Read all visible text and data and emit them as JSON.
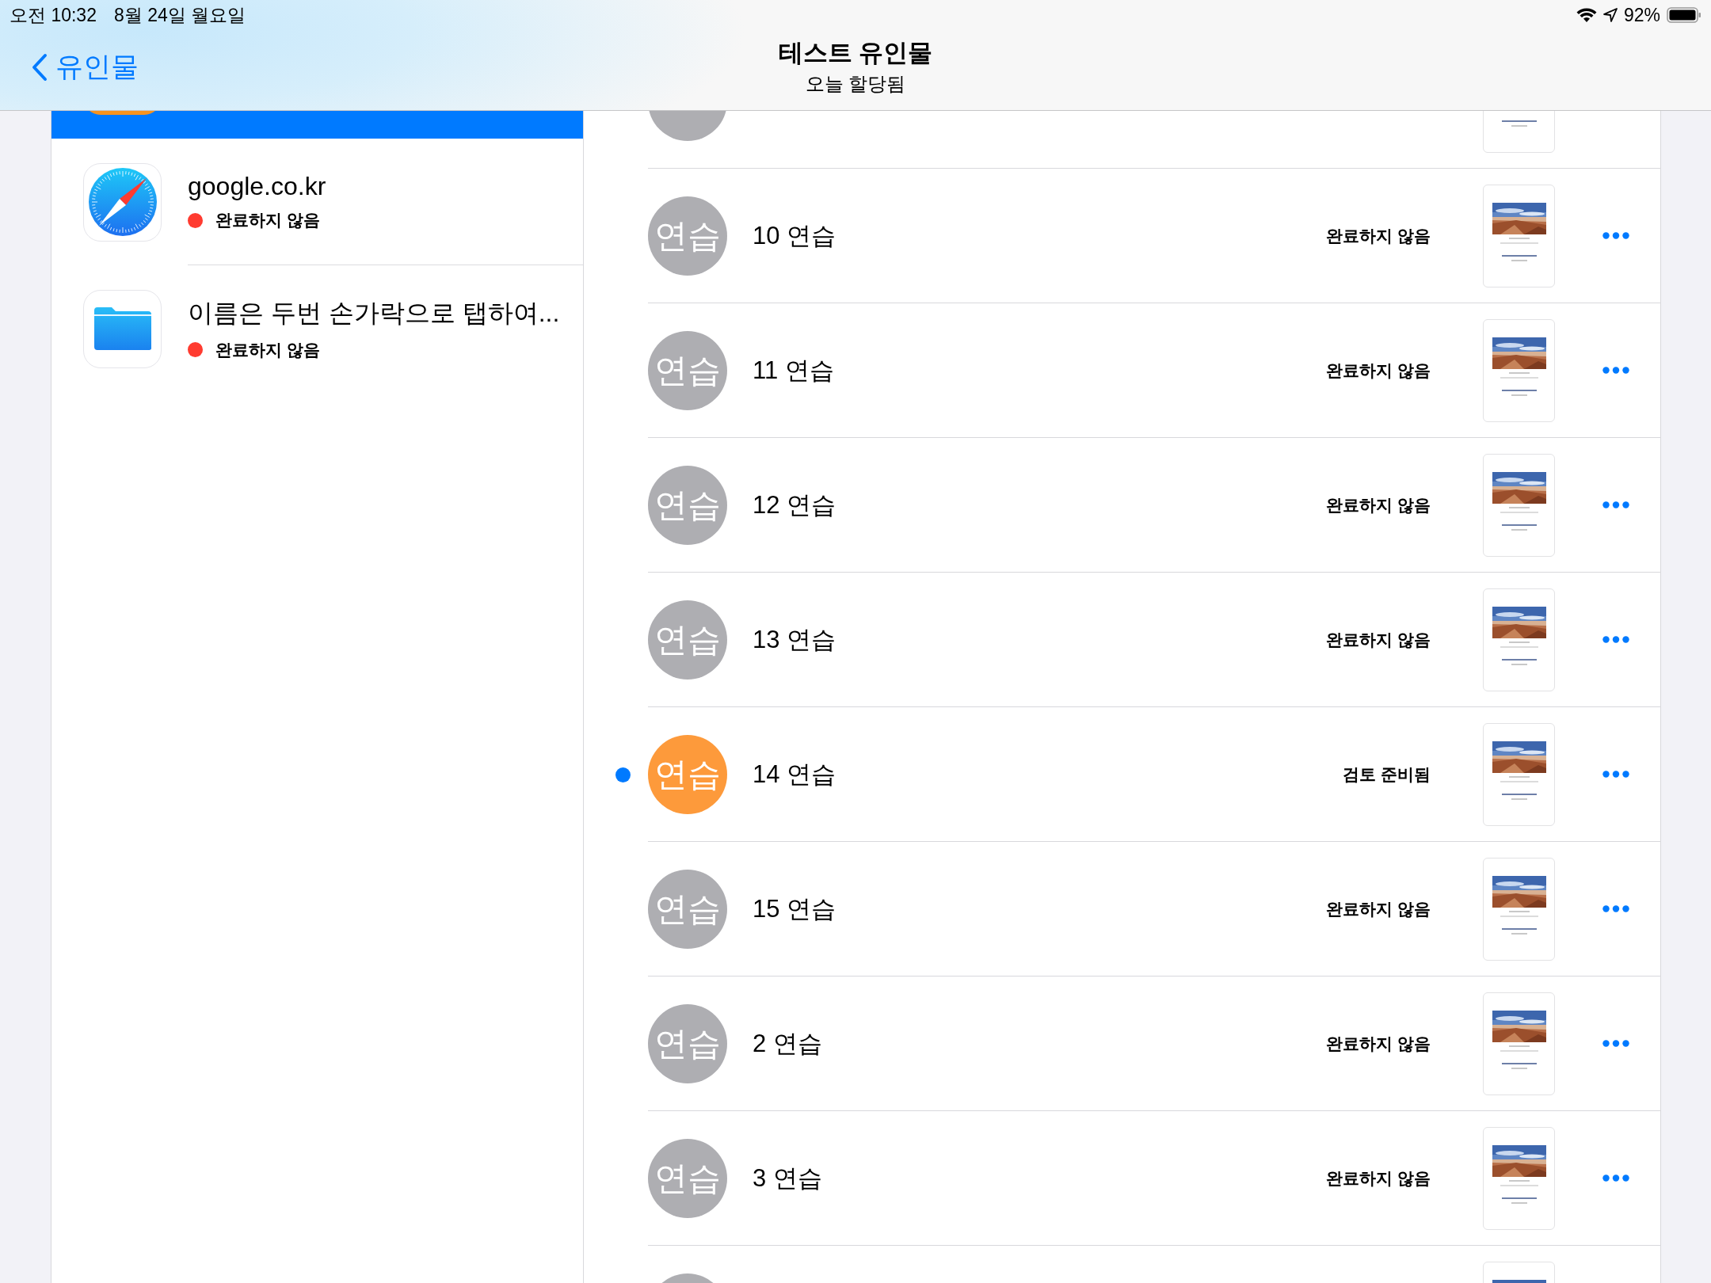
{
  "status_bar": {
    "time": "오전 10:32",
    "date": "8월 24일 월요일",
    "battery": "92%"
  },
  "nav": {
    "back": "유인물",
    "title": "테스트 유인물",
    "subtitle": "오늘 할당됨"
  },
  "sidebar": {
    "items": [
      {
        "kind": "partial",
        "selected": true
      },
      {
        "kind": "web",
        "title": "google.co.kr",
        "status": "완료하지 않음",
        "color": "#ff3b30",
        "selected": false
      },
      {
        "kind": "file",
        "title": "이름은 두번 손가락으로 탭하여...",
        "status": "완료하지 않음",
        "color": "#ff3b30",
        "selected": false
      }
    ]
  },
  "assignments": [
    {
      "kind": "partial_top",
      "color": "#aeaeb2",
      "unread": false
    },
    {
      "kind": "full",
      "avatar": "연습",
      "title": "10 연습",
      "status": "완료하지 않음",
      "color": "#aeaeb2",
      "unread": false
    },
    {
      "kind": "full",
      "avatar": "연습",
      "title": "11 연습",
      "status": "완료하지 않음",
      "color": "#aeaeb2",
      "unread": false
    },
    {
      "kind": "full",
      "avatar": "연습",
      "title": "12 연습",
      "status": "완료하지 않음",
      "color": "#aeaeb2",
      "unread": false
    },
    {
      "kind": "full",
      "avatar": "연습",
      "title": "13 연습",
      "status": "완료하지 않음",
      "color": "#aeaeb2",
      "unread": false
    },
    {
      "kind": "full",
      "avatar": "연습",
      "title": "14 연습",
      "status": "검토 준비됨",
      "color": "#fd9a3b",
      "unread": true
    },
    {
      "kind": "full",
      "avatar": "연습",
      "title": "15 연습",
      "status": "완료하지 않음",
      "color": "#aeaeb2",
      "unread": false
    },
    {
      "kind": "full",
      "avatar": "연습",
      "title": "2 연습",
      "status": "완료하지 않음",
      "color": "#aeaeb2",
      "unread": false
    },
    {
      "kind": "full",
      "avatar": "연습",
      "title": "3 연습",
      "status": "완료하지 않음",
      "color": "#aeaeb2",
      "unread": false
    },
    {
      "kind": "partial_bottom",
      "color": "#aeaeb2",
      "unread": false
    }
  ]
}
